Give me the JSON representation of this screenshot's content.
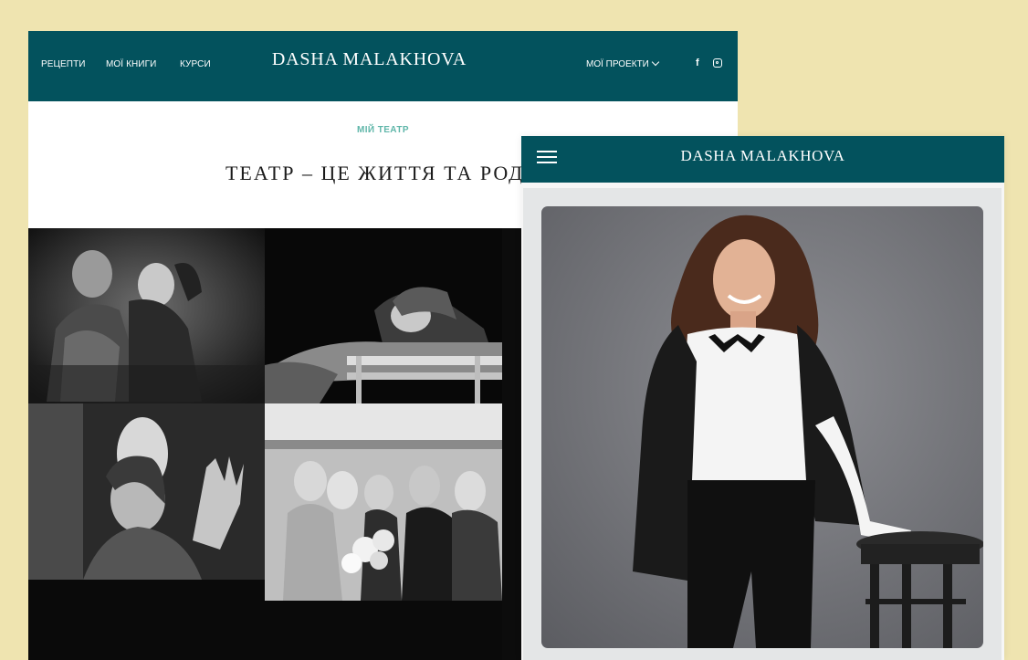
{
  "desktop": {
    "nav": {
      "links": [
        "РЕЦЕПТИ",
        "МОЇ КНИГИ",
        "КУРСИ"
      ],
      "logo": "DASHA MALAKHOVA",
      "projects_label": "МОЇ ПРОЕКТИ",
      "social": [
        {
          "icon": "facebook-icon",
          "glyph": "f"
        },
        {
          "icon": "instagram-icon",
          "glyph": ""
        }
      ]
    },
    "eyebrow": "МІЙ ТЕАТР",
    "title": "ТЕАТР – ЦЕ ЖИТТЯ ТА РОДИ",
    "gallery_photos": [
      "theatre-photo-1",
      "theatre-photo-2",
      "theatre-photo-3",
      "theatre-photo-4"
    ]
  },
  "mobile": {
    "nav": {
      "menu_icon": "hamburger-icon",
      "logo": "DASHA MALAKHOVA"
    },
    "hero_image": "portrait-photo"
  },
  "colors": {
    "background": "#efe4b0",
    "nav_teal": "#03525d",
    "eyebrow_teal": "#5fb6a9"
  }
}
